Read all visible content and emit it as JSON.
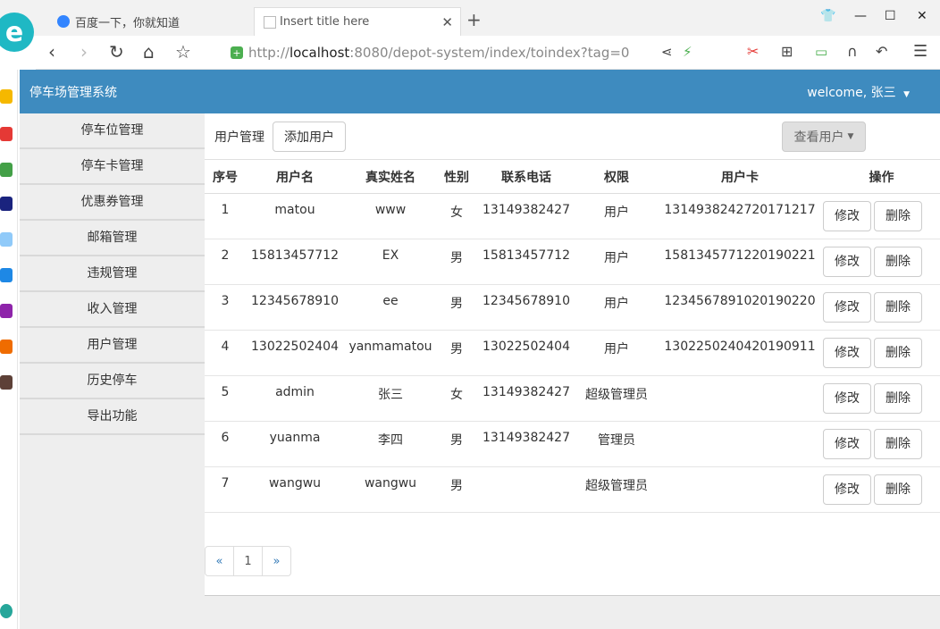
{
  "browser": {
    "tabs": [
      {
        "label": "百度一下，你就知道",
        "icon": "baidu-paw-icon"
      },
      {
        "label": "Insert title here",
        "icon": "blank-page-icon"
      }
    ],
    "new_tab": "+",
    "address": {
      "scheme": "http://",
      "host": "localhost",
      "path": ":8080/depot-system/index/toindex?tag=0"
    }
  },
  "app": {
    "title": "停车场管理系统",
    "welcome": "welcome, 张三",
    "accent": "#3e8bbf",
    "nav": [
      "停车位管理",
      "停车卡管理",
      "优惠券管理",
      "邮箱管理",
      "违规管理",
      "收入管理",
      "用户管理",
      "历史停车",
      "导出功能"
    ],
    "toolbar": {
      "crumb": "用户管理",
      "add_button": "添加用户",
      "view_button": "查看用户"
    },
    "table": {
      "headers": [
        "序号",
        "用户名",
        "真实姓名",
        "性别",
        "联系电话",
        "权限",
        "用户卡",
        "操作"
      ],
      "rows": [
        [
          "1",
          "matou",
          "www",
          "女",
          "13149382427",
          "用户",
          "1314938242720171217"
        ],
        [
          "2",
          "15813457712",
          "EX",
          "男",
          "15813457712",
          "用户",
          "1581345771220190221"
        ],
        [
          "3",
          "12345678910",
          "ee",
          "男",
          "12345678910",
          "用户",
          "1234567891020190220"
        ],
        [
          "4",
          "13022502404",
          "yanmamatou",
          "男",
          "13022502404",
          "用户",
          "1302250240420190911"
        ],
        [
          "5",
          "admin",
          "张三",
          "女",
          "13149382427",
          "超级管理员",
          ""
        ],
        [
          "6",
          "yuanma",
          "李四",
          "男",
          "13149382427",
          "管理员",
          ""
        ],
        [
          "7",
          "wangwu",
          "wangwu",
          "男",
          "",
          "超级管理员",
          ""
        ]
      ],
      "edit_label": "修改",
      "delete_label": "删除"
    },
    "pager": {
      "prev": "«",
      "current": "1",
      "next": "»"
    }
  }
}
